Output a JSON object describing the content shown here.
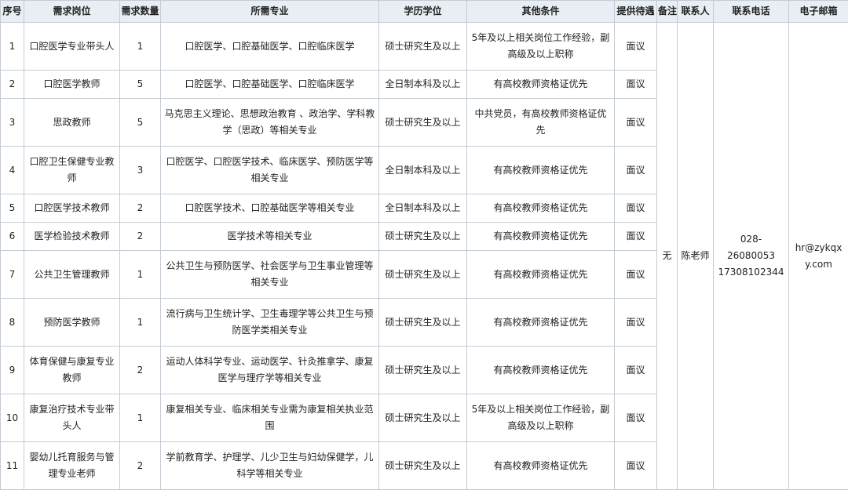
{
  "table": {
    "headers": [
      "序号",
      "需求岗位",
      "需求数量",
      "所需专业",
      "学历学位",
      "其他条件",
      "提供待遇",
      "备注",
      "联系人",
      "联系电话",
      "电子邮箱"
    ],
    "rows": [
      {
        "no": "1",
        "position": "口腔医学专业带头人",
        "count": "1",
        "major": "口腔医学、口腔基础医学、口腔临床医学",
        "degree": "硕士研究生及以上",
        "conditions": "5年及以上相关岗位工作经验，副高级及以上职称",
        "pay": "面议"
      },
      {
        "no": "2",
        "position": "口腔医学教师",
        "count": "5",
        "major": "口腔医学、口腔基础医学、口腔临床医学",
        "degree": "全日制本科及以上",
        "conditions": "有高校教师资格证优先",
        "pay": "面议"
      },
      {
        "no": "3",
        "position": "思政教师",
        "count": "5",
        "major": "马克思主义理论、思想政治教育 、政治学、学科教学（思政）等相关专业",
        "degree": "硕士研究生及以上",
        "conditions": "中共党员，有高校教师资格证优先",
        "pay": "面议"
      },
      {
        "no": "4",
        "position": "口腔卫生保健专业教师",
        "count": "3",
        "major": "口腔医学、口腔医学技术、临床医学、预防医学等相关专业",
        "degree": "全日制本科及以上",
        "conditions": "有高校教师资格证优先",
        "pay": "面议"
      },
      {
        "no": "5",
        "position": "口腔医学技术教师",
        "count": "2",
        "major": "口腔医学技术、口腔基础医学等相关专业",
        "degree": "全日制本科及以上",
        "conditions": "有高校教师资格证优先",
        "pay": "面议"
      },
      {
        "no": "6",
        "position": "医学检验技术教师",
        "count": "2",
        "major": "医学技术等相关专业",
        "degree": "硕士研究生及以上",
        "conditions": "有高校教师资格证优先",
        "pay": "面议"
      },
      {
        "no": "7",
        "position": "公共卫生管理教师",
        "count": "1",
        "major": "公共卫生与预防医学、社会医学与卫生事业管理等相关专业",
        "degree": "硕士研究生及以上",
        "conditions": "有高校教师资格证优先",
        "pay": "面议"
      },
      {
        "no": "8",
        "position": "预防医学教师",
        "count": "1",
        "major": "流行病与卫生统计学、卫生毒理学等公共卫生与预防医学类相关专业",
        "degree": "硕士研究生及以上",
        "conditions": "有高校教师资格证优先",
        "pay": "面议"
      },
      {
        "no": "9",
        "position": "体育保健与康复专业教师",
        "count": "2",
        "major": "运动人体科学专业、运动医学、针灸推拿学、康复医学与理疗学等相关专业",
        "degree": "硕士研究生及以上",
        "conditions": "有高校教师资格证优先",
        "pay": "面议"
      },
      {
        "no": "10",
        "position": "康复治疗技术专业带头人",
        "count": "1",
        "major": "康复相关专业、临床相关专业需为康复相关执业范围",
        "degree": "硕士研究生及以上",
        "conditions": "5年及以上相关岗位工作经验，副高级及以上职称",
        "pay": "面议"
      },
      {
        "no": "11",
        "position": "婴幼儿托育服务与管理专业老师",
        "count": "2",
        "major": "学前教育学、护理学、儿少卫生与妇幼保健学，儿科学等相关专业",
        "degree": "硕士研究生及以上",
        "conditions": "有高校教师资格证优先",
        "pay": "面议"
      }
    ],
    "merged": {
      "remark": "无",
      "contact": "陈老师",
      "phone_lines": [
        "028-",
        "26080053",
        "17308102344"
      ],
      "email": "hr@zykqxy.com"
    }
  }
}
